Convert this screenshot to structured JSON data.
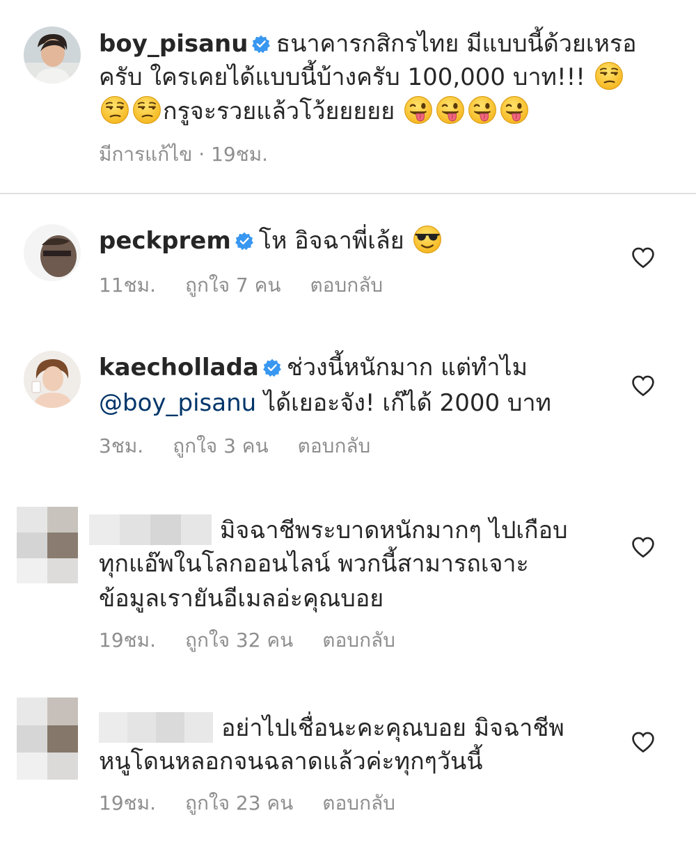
{
  "caption": {
    "username": "boy_pisanu",
    "line1": "ธนาคารกสิกรไทย มีแบบนี้ด้วยเหรอ",
    "line2": "ครับ ใครเคยได้แบบนี้บ้างครับ 100,000 บาท!!!",
    "line3": "กรูจะรวยแล้วโว้ยยยยย",
    "meta": "มีการแก้ไข · 19ชม."
  },
  "comments": [
    {
      "username": "peckprem",
      "line1": "โห อิจฉาพี่เล้ย",
      "time": "11ชม.",
      "likes": "ถูกใจ 7 คน",
      "reply": "ตอบกลับ"
    },
    {
      "username": "kaechollada",
      "line1": "ช่วงนี้หนักมาก แต่ทำไม",
      "mention": "@boy_pisanu",
      "line2": "ได้เยอะจัง! เก๊ได้ 2000 บาท",
      "time": "3ชม.",
      "likes": "ถูกใจ 3 คน",
      "reply": "ตอบกลับ"
    },
    {
      "line1": "มิจฉาชีพระบาดหนักมากๆ ไปเกือบ",
      "line2": "ทุกแอ๊พในโลกออนไลน์ พวกนี้สามารถเจาะ",
      "line3": "ข้อมูลเรายันอีเมลอ่ะคุณบอย",
      "time": "19ชม.",
      "likes": "ถูกใจ 32 คน",
      "reply": "ตอบกลับ"
    },
    {
      "line1": "อย่าไปเชื่อนะคะคุณบอย มิจฉาชีพ",
      "line2": "หนูโดนหลอกจนฉลาดแล้วค่ะทุกๆวันนี้",
      "time": "19ชม.",
      "likes": "ถูกใจ 23 คน",
      "reply": "ตอบกลับ"
    }
  ],
  "icons": {
    "verified": "verified-badge-icon",
    "like": "heart-outline-icon",
    "unamused": "unamused-face-emoji",
    "winking_tongue": "winking-face-with-tongue-emoji",
    "sunglasses": "smiling-face-with-sunglasses-emoji"
  },
  "colors": {
    "text": "#262626",
    "meta": "#8e8e8e",
    "verified": "#3897f0",
    "mention": "#003569"
  }
}
